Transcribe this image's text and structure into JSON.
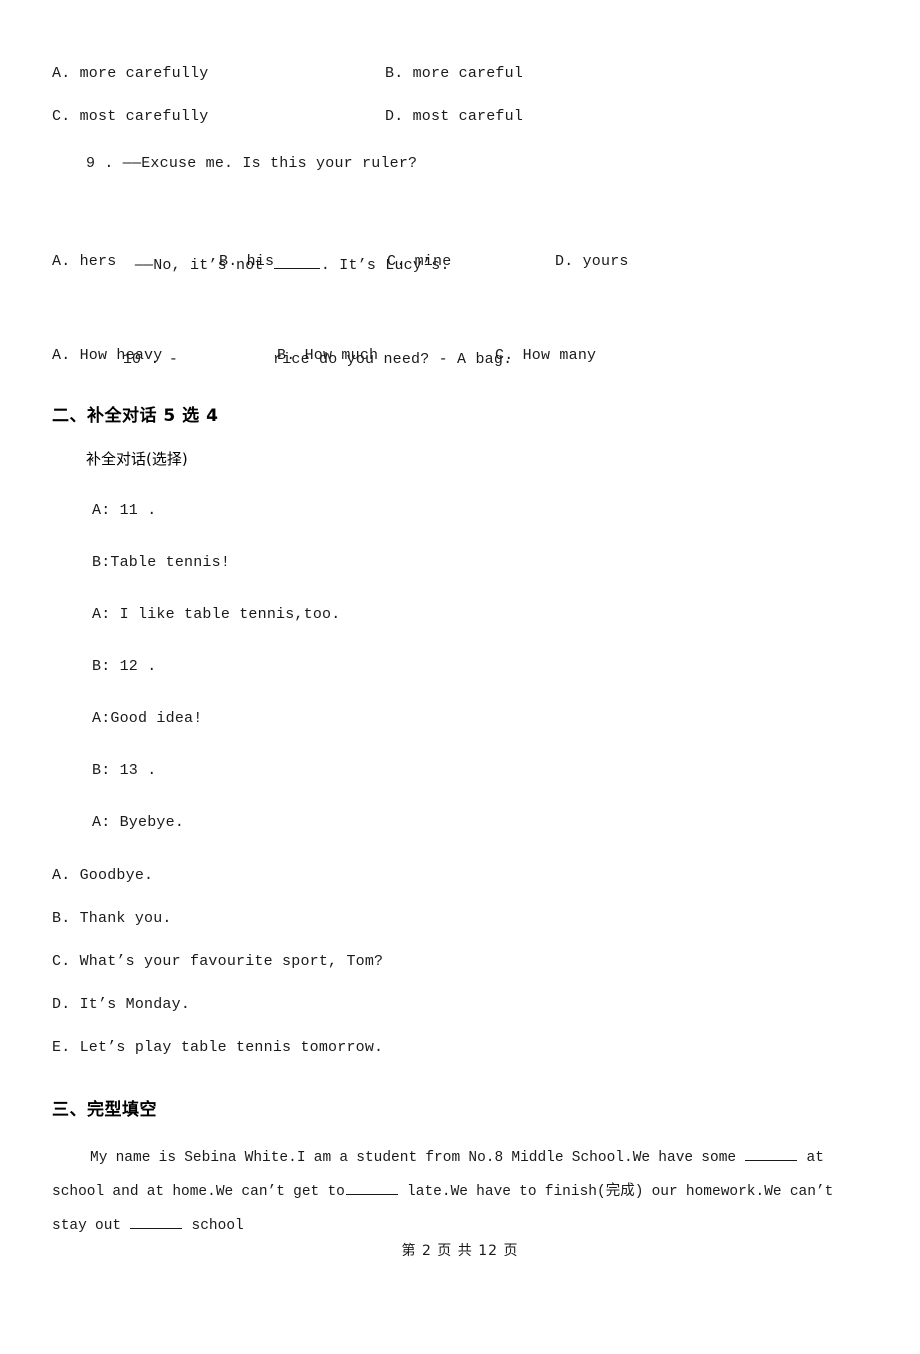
{
  "document": {
    "type": "exam-paper",
    "language": "zh-CN/en",
    "page_number_text": "第 2 页 共 12 页"
  },
  "question_8_options": {
    "row1": {
      "a": "A. more carefully",
      "b": "B. more careful"
    },
    "row2": {
      "c": "C. most carefully",
      "d": "D. most careful"
    }
  },
  "question_9": {
    "stem_line1": "9 . ——Excuse me. Is this your ruler?",
    "stem_line2_before": "——No, it’s not ",
    "stem_line2_after": ". It’s Lucy’s.",
    "options": {
      "a": "A. hers",
      "b": "B. his",
      "c": "C. mine",
      "d": "D. yours"
    }
  },
  "question_10": {
    "stem_before": "10 . -",
    "stem_after": "rice do you need? - A bag.",
    "options": {
      "a": "A. How heavy",
      "b": "B. How much",
      "c": "C. How many"
    }
  },
  "section_two": {
    "heading": "二、补全对话 5 选 4",
    "note": "补全对话(选择)",
    "dialogue": [
      "A: 11 .",
      "B:Table tennis!",
      "A: I like table tennis,too.",
      "B: 12 .",
      "A:Good idea!",
      "B: 13 .",
      "A: Byebye."
    ],
    "answer_bank": [
      "A. Goodbye.",
      "B. Thank you.",
      "C. What’s your favourite sport, Tom?",
      "D. It’s Monday.",
      "E. Let’s play table tennis tomorrow."
    ]
  },
  "section_three": {
    "heading": "三、完型填空",
    "passage_parts": {
      "p1": "My name is Sebina White.I am a student from No.8 Middle School.We have some ",
      "p2": " at school and at home.We can’t get to",
      "p3": " late.We have to finish(完成) our homework.We can’t stay out ",
      "p4": " school"
    }
  }
}
